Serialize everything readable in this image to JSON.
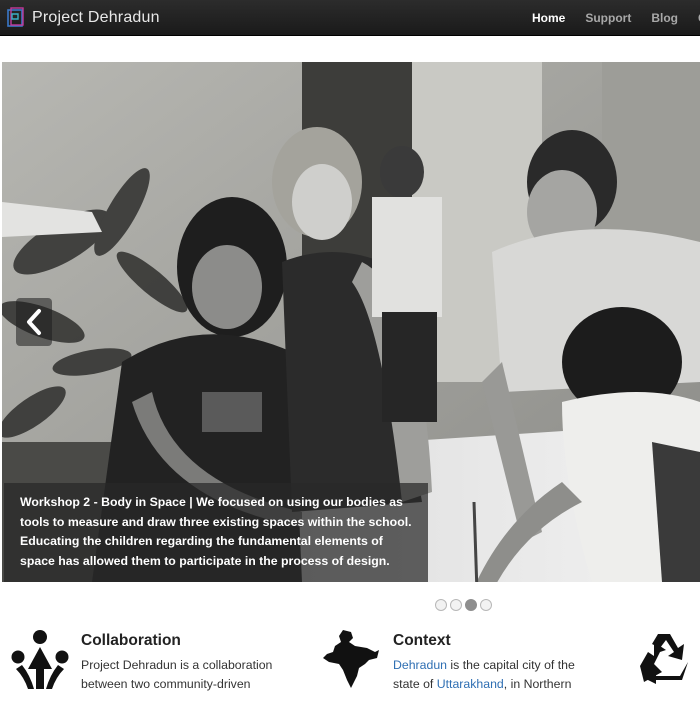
{
  "navbar": {
    "brand": "Project Dehradun",
    "links": [
      {
        "label": "Home",
        "active": true
      },
      {
        "label": "Support",
        "active": false
      },
      {
        "label": "Blog",
        "active": false
      },
      {
        "label": "C",
        "active": false
      }
    ]
  },
  "carousel": {
    "caption": "Workshop 2 - Body in Space | We focused on using our bodies as tools to measure and draw three existing spaces within the school. Educating the children regarding the fundamental elements of space has allowed them to participate in the process of design.",
    "prev_icon": "chevron-left-icon",
    "slide_count": 4,
    "active_index": 2
  },
  "features": {
    "collaboration": {
      "title": "Collaboration",
      "line1": "Project Dehradun is a collaboration",
      "line2": "between two community-driven"
    },
    "context": {
      "title": "Context",
      "link1": "Dehradun",
      "line1_rest": " is the capital city of the",
      "line2_start": "state of ",
      "link2": "Uttarakhand",
      "line2_rest": ", in Northern"
    },
    "recycle_icon": "recycle-icon"
  },
  "colors": {
    "navbar": "#1f1f1f",
    "link": "#2f6fb3",
    "caption_bg": "#282828"
  }
}
